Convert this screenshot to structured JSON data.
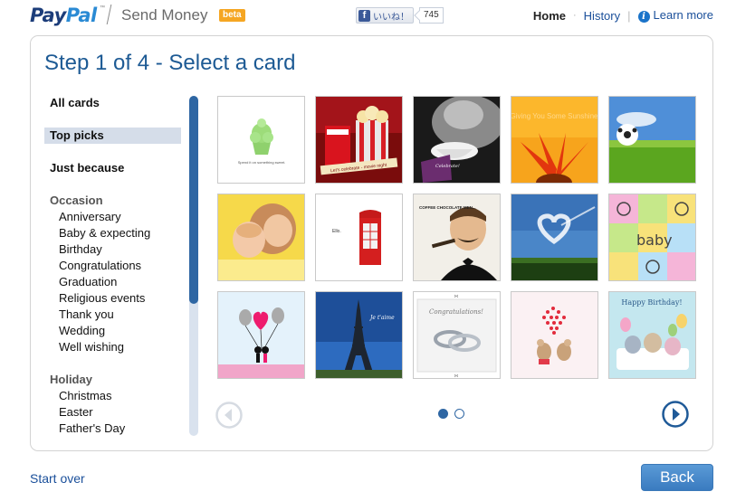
{
  "header": {
    "logo_pay": "Pay",
    "logo_pal": "Pal",
    "logo_tm": "™",
    "app_name": "Send Money",
    "beta_badge": "beta",
    "fb_like_label": "いいね！",
    "fb_like_icon": "f",
    "fb_like_count": "745",
    "nav": {
      "home": "Home",
      "history": "History",
      "learn_more": "Learn more",
      "info_icon": "i"
    }
  },
  "main": {
    "title": "Step 1 of 4 - Select a card",
    "sidebar": {
      "top_items": [
        {
          "label": "All cards",
          "selected": false
        },
        {
          "label": "Top picks",
          "selected": true
        },
        {
          "label": "Just because",
          "selected": false
        }
      ],
      "groups": [
        {
          "label": "Occasion",
          "items": [
            "Anniversary",
            "Baby & expecting",
            "Birthday",
            "Congratulations",
            "Graduation",
            "Religious events",
            "Thank you",
            "Wedding",
            "Well wishing"
          ]
        },
        {
          "label": "Holiday",
          "items": [
            "Christmas",
            "Easter",
            "Father's Day"
          ]
        }
      ]
    },
    "cards": [
      {
        "name": "cupcake",
        "caption": "Spend it on something sweet."
      },
      {
        "name": "popcorn-movie",
        "caption": "Let's celebrate - movie night"
      },
      {
        "name": "celebrate-coffee",
        "caption": "Celebrate!"
      },
      {
        "name": "sunflower-sunshine",
        "caption": "Giving You Some Sunshine"
      },
      {
        "name": "soccer-field",
        "caption": ""
      },
      {
        "name": "baby-mother",
        "caption": ""
      },
      {
        "name": "phone-booth",
        "caption": "Ello."
      },
      {
        "name": "coffee-chocolate-men",
        "caption": "COFFEE CHOCOLATE MEN..."
      },
      {
        "name": "cloud-heart-sky",
        "caption": ""
      },
      {
        "name": "baby-pattern",
        "caption": "baby"
      },
      {
        "name": "heart-balloon-couple",
        "caption": ""
      },
      {
        "name": "eiffel-tower",
        "caption": "Je t'aime"
      },
      {
        "name": "congratulations-rings",
        "caption": "Congratulations!"
      },
      {
        "name": "mice-hearts",
        "caption": ""
      },
      {
        "name": "happy-birthday-party",
        "caption": "Happy Birthday!"
      }
    ],
    "pager": {
      "current_page": 1,
      "total_pages": 2
    }
  },
  "footer": {
    "start_over": "Start over",
    "back": "Back"
  },
  "colors": {
    "brand_dark": "#1c3d7a",
    "brand_light": "#2a8ad4",
    "title_blue": "#1d5a94",
    "link_blue": "#1a4f9a",
    "beta_orange": "#f5a623",
    "selected_bg": "#d5dde9",
    "scroll_thumb": "#2e66a3",
    "back_button": "#3a7bc0"
  }
}
